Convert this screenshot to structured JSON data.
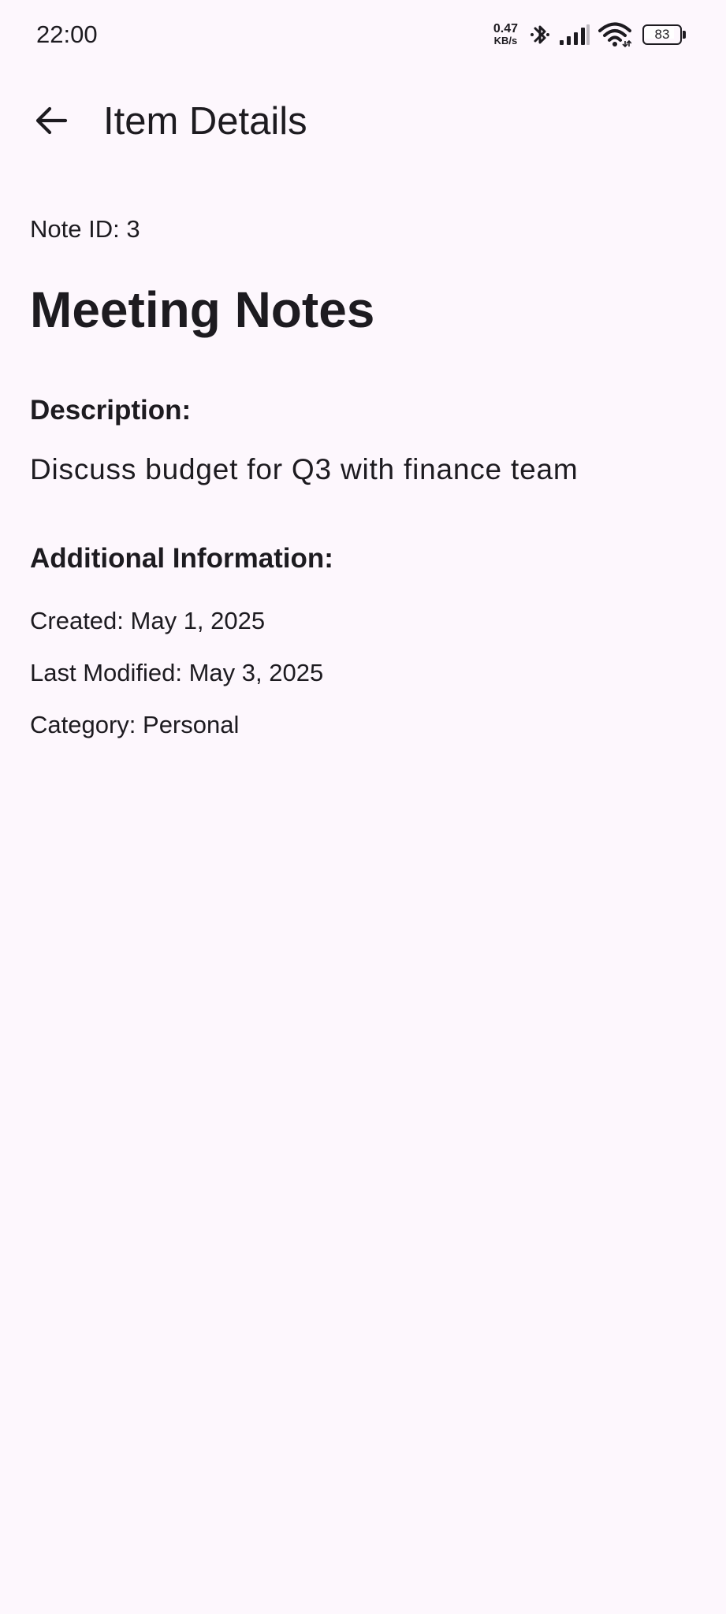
{
  "status_bar": {
    "time": "22:00",
    "net_speed_value": "0.47",
    "net_speed_unit": "KB/s",
    "battery_level": "83",
    "icons": [
      "bluetooth-icon",
      "signal-icon",
      "wifi-icon",
      "battery-icon"
    ]
  },
  "app_bar": {
    "back_icon": "arrow-back-icon",
    "title": "Item Details"
  },
  "note": {
    "id_text": "Note ID: 3",
    "title": "Meeting Notes",
    "description_label": "Description:",
    "description": "Discuss budget for Q3 with finance team",
    "additional_label": "Additional Information:",
    "created": "Created: May 1, 2025",
    "last_modified": "Last Modified: May 3, 2025",
    "category": "Category: Personal"
  },
  "colors": {
    "background": "#fdf7fd",
    "text": "#1d1b20"
  }
}
